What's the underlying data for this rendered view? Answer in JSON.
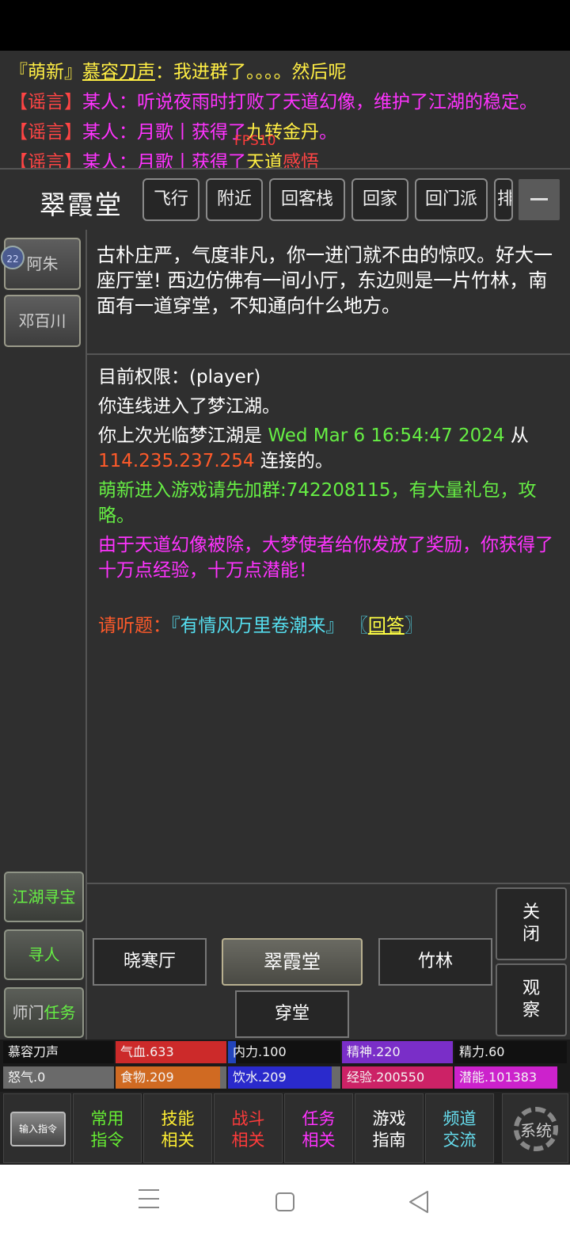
{
  "chat": {
    "line1": {
      "open": "『萌新』",
      "name": "慕容刀声",
      "text": "：我进群了。。。。然后呢"
    },
    "line2": {
      "tag": "【谣言】",
      "text": "某人：听说夜雨时打败了天道幻像，维护了江湖的稳定。"
    },
    "line3": {
      "tag": "【谣言】",
      "pre": "某人：月歌丨获得了",
      "item": "九转金丹",
      "post": "。"
    },
    "line4": {
      "tag": "【谣言】",
      "pre": "某人：月歌丨获得了",
      "item": "天道",
      "post": "感悟"
    },
    "fps": "FPS10"
  },
  "room": {
    "title": "翠霞堂",
    "quick_buttons": [
      "飞行",
      "附近",
      "回客栈",
      "回家",
      "回门派",
      "排"
    ]
  },
  "npcs": [
    {
      "name": "阿朱",
      "badge": "22"
    },
    {
      "name": "邓百川"
    }
  ],
  "side_buttons": {
    "treasure": "江湖寻宝",
    "find": "寻人",
    "quest_a": "师门",
    "quest_b": "任务"
  },
  "description": "古朴庄严，气度非凡，你一进门就不由的惊叹。好大一座厅堂! 西边仿佛有一间小厅，东边则是一片竹林，南面有一道穿堂，不知通向什么地方。",
  "log": {
    "perm": "目前权限：(player)",
    "connected": "你连线进入了梦江湖。",
    "last_pre": "你上次光临梦江湖是 ",
    "last_time": "Wed Mar  6 16:54:47 2024",
    "last_from": " 从",
    "last_ip": "114.235.237.254",
    "last_post": " 连接的。",
    "group": "萌新进入游戏请先加群:742208115，有大量礼包，攻略。",
    "reward": "由于天道幻像被除，大梦使者给你发放了奖励，你获得了十万点经验，十万点潜能！",
    "quiz_label": "请听题：",
    "quiz_question": "『有情风万里卷潮来』",
    "quiz_open": "〖",
    "quiz_answer": "回答",
    "quiz_close": "〗"
  },
  "exits": {
    "west": "晓寒厅",
    "current": "翠霞堂",
    "east": "竹林",
    "south": "穿堂"
  },
  "actions": {
    "close_a": "关",
    "close_b": "闭",
    "look_a": "观",
    "look_b": "察"
  },
  "stats": {
    "name": "慕容刀声",
    "hp": {
      "label": "气血.633",
      "fill": 1.0,
      "color": "#cc2a2a"
    },
    "mp": {
      "label": "内力.100",
      "fill": 0.07,
      "color": "#2244bb"
    },
    "spirit": {
      "label": "精神.220",
      "fill": 1.0,
      "color": "#7a2ec8"
    },
    "energy": {
      "label": "精力.60",
      "fill": 0.0,
      "color": "#2a8a2a"
    },
    "rage": {
      "label": "怒气.0",
      "fill": 0.0,
      "color": "#888888"
    },
    "food": {
      "label": "食物.209",
      "fill": 0.94,
      "color": "#d06a22"
    },
    "water": {
      "label": "饮水.209",
      "fill": 0.92,
      "color": "#2a2acc"
    },
    "exp": {
      "label": "经验.200550",
      "fill": 1.0,
      "color": "#cc2266"
    },
    "pot": {
      "label": "潜能.101383",
      "fill": 1.0,
      "color": "#cc22cc"
    }
  },
  "nav": {
    "input": "输入指令",
    "items": [
      {
        "a": "常用",
        "b": "指令",
        "color": "#66ee33"
      },
      {
        "a": "技能",
        "b": "相关",
        "color": "#ffee33"
      },
      {
        "a": "战斗",
        "b": "相关",
        "color": "#ff3b3b"
      },
      {
        "a": "任务",
        "b": "相关",
        "color": "#ff33ff"
      },
      {
        "a": "游戏",
        "b": "指南",
        "color": "#ffffff"
      },
      {
        "a": "频道",
        "b": "交流",
        "color": "#66ddee"
      }
    ],
    "system": "系统"
  }
}
